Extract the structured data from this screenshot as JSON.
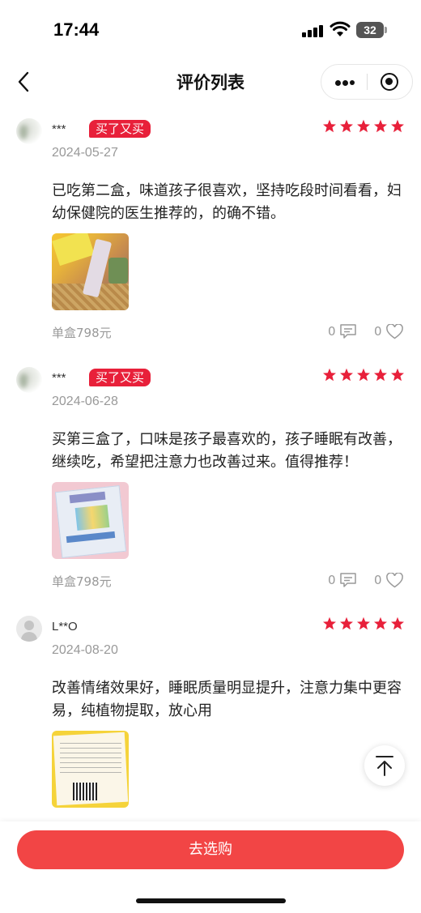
{
  "status_bar": {
    "time": "17:44",
    "battery": "32"
  },
  "nav": {
    "title": "评价列表"
  },
  "reviews": [
    {
      "username": "*** ",
      "badge": "买了又买",
      "rating": 5,
      "date": "2024-05-27",
      "content": "已吃第二盒，味道孩子很喜欢，坚持吃段时间看看，妇幼保健院的医生推荐的，的确不错。",
      "price": "单盒798元",
      "comment_count": "0",
      "like_count": "0"
    },
    {
      "username": "***",
      "badge": "买了又买",
      "rating": 5,
      "date": "2024-06-28",
      "content": "买第三盒了，口味是孩子最喜欢的，孩子睡眠有改善，继续吃，希望把注意力也改善过来。值得推荐！",
      "price": "单盒798元",
      "comment_count": "0",
      "like_count": "0"
    },
    {
      "username": "L**O",
      "rating": 5,
      "date": "2024-08-20",
      "content": "改善情绪效果好，睡眠质量明显提升，注意力集中更容易，纯植物提取，放心用"
    }
  ],
  "footer": {
    "buy_label": "去选购"
  },
  "colors": {
    "accent": "#f24545",
    "badge": "#e8203a",
    "star": "#e8203a"
  },
  "icons": [
    "back-icon",
    "more-icon",
    "close-icon",
    "star-icon",
    "comment-icon",
    "heart-icon",
    "back-to-top-icon",
    "avatar-icon"
  ]
}
